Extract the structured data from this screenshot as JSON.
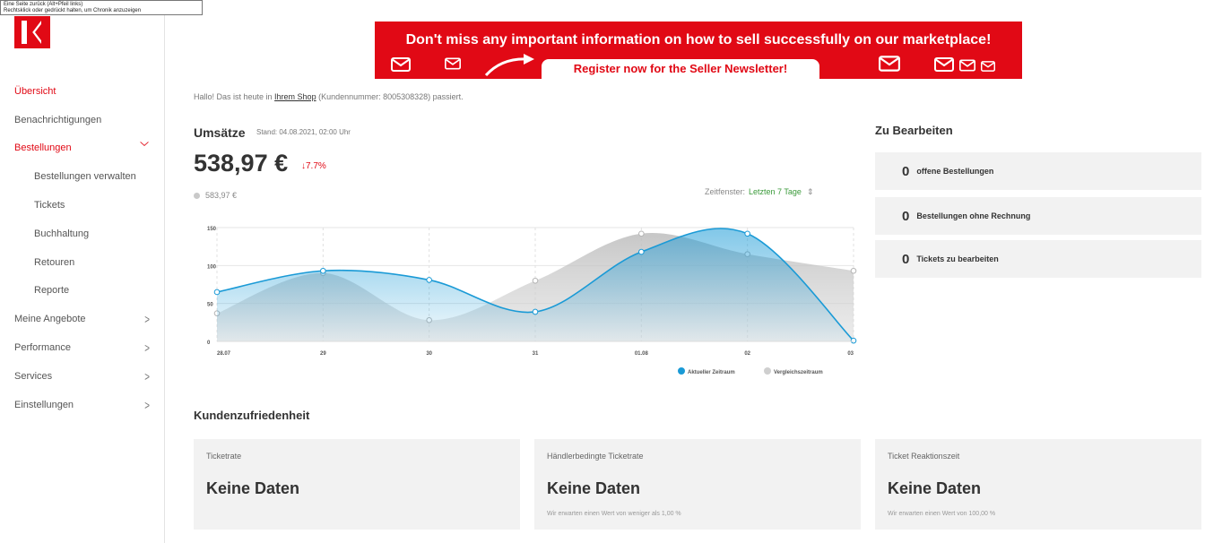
{
  "tooltip": {
    "line1": "Eine Seite zurück (Alt+Pfeil links)",
    "line2": "Rechtsklick oder gedrückt halten, um Chronik anzuzeigen"
  },
  "sidebar": {
    "items": [
      {
        "label": "Übersicht"
      },
      {
        "label": "Benachrichtigungen"
      },
      {
        "label": "Bestellungen"
      },
      {
        "label": "Bestellungen verwalten"
      },
      {
        "label": "Tickets"
      },
      {
        "label": "Buchhaltung"
      },
      {
        "label": "Retouren"
      },
      {
        "label": "Reporte"
      },
      {
        "label": "Meine Angebote"
      },
      {
        "label": "Performance"
      },
      {
        "label": "Services"
      },
      {
        "label": "Einstellungen"
      }
    ]
  },
  "banner": {
    "title": "Don't miss any important information on how to sell successfully on our marketplace!",
    "button": "Register now for the Seller Newsletter!"
  },
  "greeting": {
    "prefix": "Hallo! Das ist heute in ",
    "shop_link": "Ihrem Shop",
    "suffix": " (Kundennummer: 8005308328) passiert."
  },
  "sales": {
    "title": "Umsätze",
    "stand": "Stand: 04.08.2021, 02:00 Uhr",
    "amount": "538,97 €",
    "change": "↓7.7%",
    "compare_value": "583,97 €",
    "time_window_label": "Zeitfenster:",
    "time_window_value": "Letzten 7 Tage",
    "time_window_arrows": "⇕"
  },
  "chart_data": {
    "type": "area",
    "categories": [
      "28.07",
      "29",
      "30",
      "31",
      "01.08",
      "02",
      "03"
    ],
    "ylim": [
      0,
      150
    ],
    "yticks": [
      0,
      50,
      100,
      150
    ],
    "grid": true,
    "legend_position": "bottom-right",
    "series": [
      {
        "name": "Aktueller Zeitraum",
        "color": "#1a9ad6",
        "values": [
          65,
          93,
          81,
          39,
          118,
          142,
          1
        ]
      },
      {
        "name": "Vergleichszeitraum",
        "color": "#c9c9c9",
        "values": [
          37,
          90,
          28,
          80,
          142,
          115,
          93
        ]
      }
    ]
  },
  "todo": {
    "title": "Zu Bearbeiten",
    "items": [
      {
        "count": "0",
        "label": "offene Bestellungen"
      },
      {
        "count": "0",
        "label": "Bestellungen ohne Rechnung"
      },
      {
        "count": "0",
        "label": "Tickets zu bearbeiten"
      }
    ]
  },
  "satisfaction": {
    "title": "Kundenzufriedenheit",
    "cards": [
      {
        "title": "Ticketrate",
        "value": "Keine Daten",
        "note": ""
      },
      {
        "title": "Händlerbedingte Ticketrate",
        "value": "Keine Daten",
        "note": "Wir erwarten einen Wert von weniger als 1,00 %"
      },
      {
        "title": "Ticket Reaktionszeit",
        "value": "Keine Daten",
        "note": "Wir erwarten einen Wert von 100,00 %"
      }
    ]
  },
  "colors": {
    "brand": "#e10915",
    "current": "#1a9ad6",
    "compare": "#c9c9c9",
    "window": "#3a9a3a"
  }
}
